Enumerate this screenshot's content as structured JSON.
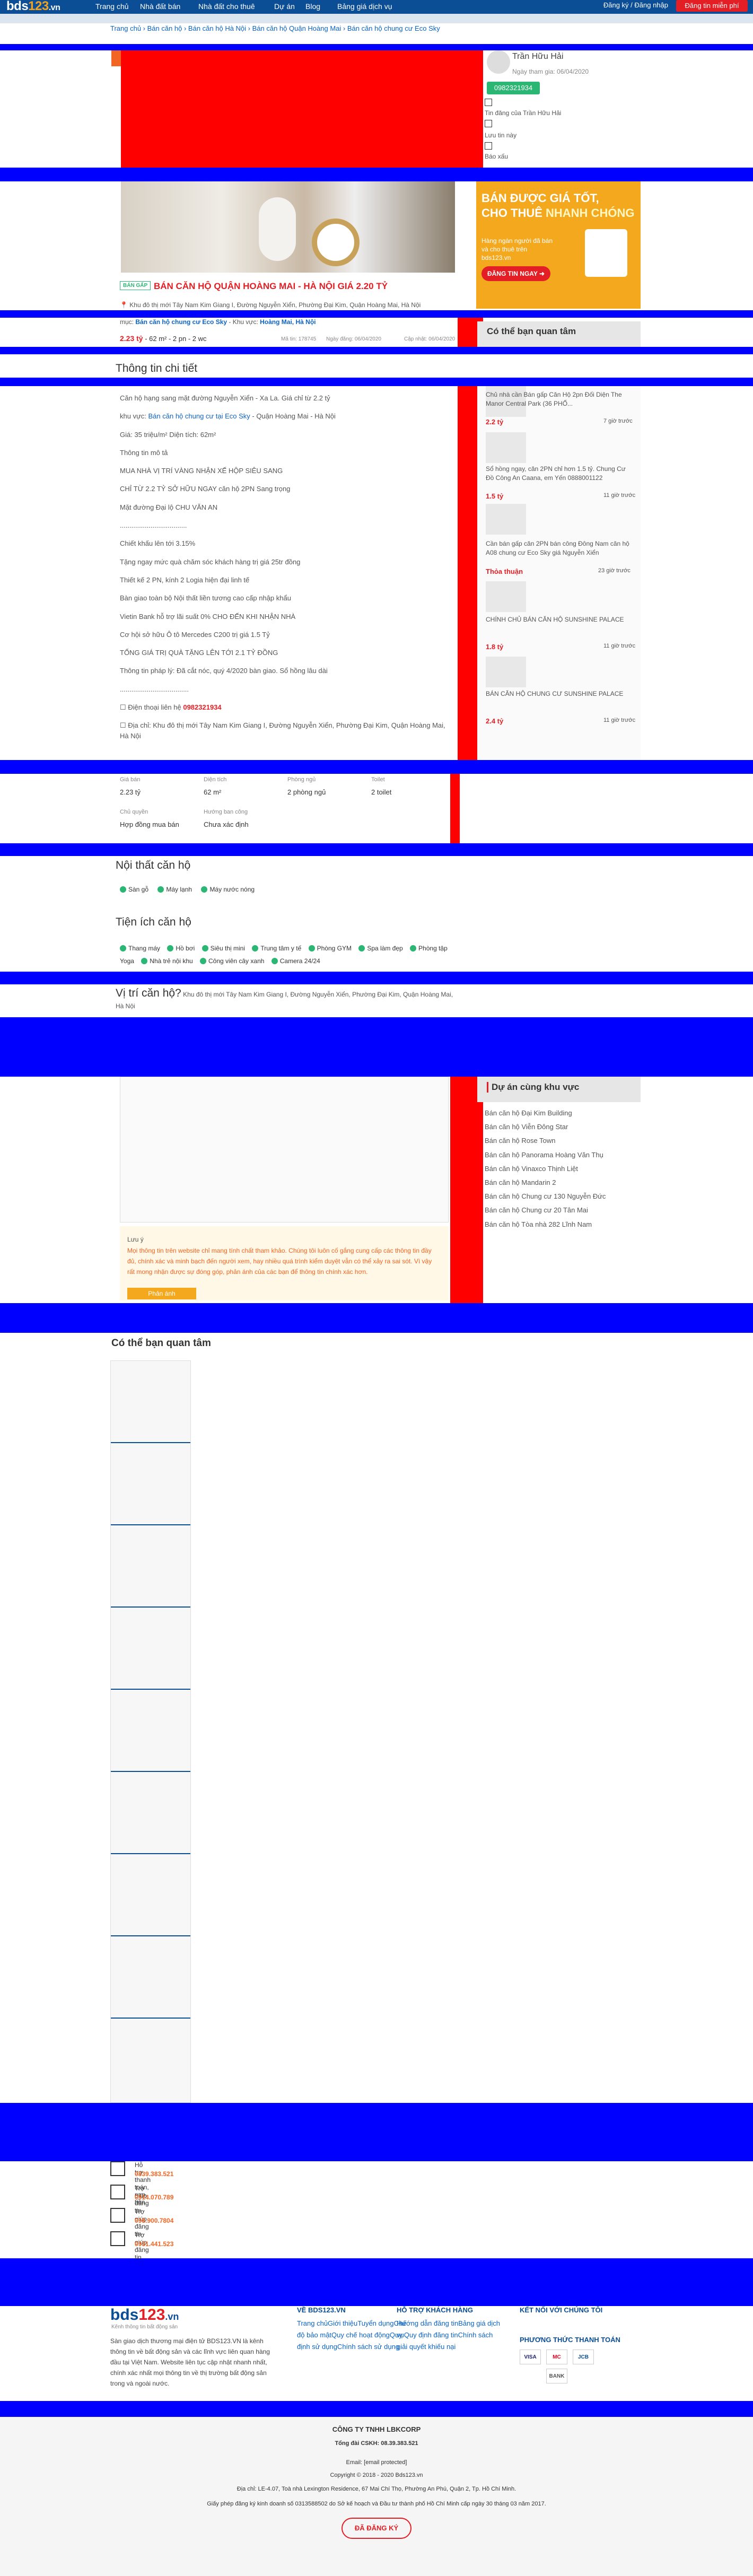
{
  "header": {
    "logo_main": "bds",
    "logo_num": "123",
    "logo_tld": ".vn",
    "nav": [
      "Trang chủ",
      "Nhà đất bán",
      "Nhà đất cho thuê",
      "Dự án",
      "Blog",
      "Bảng giá dịch vụ"
    ],
    "login": "Đăng ký / Đăng nhập",
    "post_button": "Đăng tin miễn phí"
  },
  "breadcrumb": "Trang chủ  ›  Bán căn hộ  ›  Bán căn hộ Hà Nội  ›  Bán căn hộ Quận Hoàng Mai  ›  Bán căn hộ chung cư Eco Sky",
  "seller": {
    "name": "Trần Hữu Hải",
    "joined": "Ngày tham gia: 06/04/2020",
    "phone": "0982321934",
    "more_posts": "Tin đăng của Trần Hữu Hải",
    "save": "Lưu tin này",
    "report": "Báo xấu"
  },
  "banner": {
    "line1": "BÁN ",
    "line1b": "ĐƯỢC GIÁ TỐT,",
    "line2": "CHO THUÊ ",
    "line2b": "NHANH CHÓNG",
    "text": "Hàng ngàn người đã bán và cho thuê trên bds123.vn",
    "cta": "ĐĂNG TIN NGAY ➜"
  },
  "listing": {
    "badge": "BÁN GẤP",
    "title": "BÁN CĂN HỘ QUẬN HOÀNG MAI - HÀ NỘI GIÁ 2.20 TỶ",
    "address": "Khu đô thị mới Tây Nam Kim Giang I, Đường Nguyễn Xiển, Phường Đại Kim, Quận Hoàng Mai, Hà Nội",
    "cat_label": "mục: ",
    "category": "Bán căn hộ chung cư Eco Sky",
    "area_label": " - Khu vực: ",
    "area": "Hoàng Mai, Hà Nội",
    "price": "2.23 tỷ",
    "specs": " - 62 m² - 2 pn - 2 wc",
    "code": "Mã tin: 178745",
    "posted": "Ngày đăng: 06/04/2020",
    "updated": "Cập nhật: 06/04/2020"
  },
  "detail": {
    "heading": "Thông tin chi tiết",
    "lines": [
      "Căn hộ hạng sang mặt đường Nguyễn Xiển - Xa La. Giá chỉ từ 2.2 tỷ",
      "khu vực: Bán căn hộ chung cư tại Eco Sky - Quận Hoàng Mai - Hà Nội",
      "Giá: 35 triệu/m² Diện tích: 62m²",
      "Thông tin mô tả",
      "MUA NHÀ VỊ TRÍ VÀNG NHẬN XẾ HỘP SIÊU SANG",
      "CHỈ TỪ 2.2 TỶ SỞ HỮU NGAY căn hộ 2PN Sang trọng",
      "Mặt đường Đại lộ CHU VĂN AN",
      "...................................",
      "Chiết khấu lên tới 3.15%",
      "Tặng ngay mức quà chăm sóc khách hàng trị giá 25tr đồng",
      "Thiết kế 2 PN, kính 2 Logia hiện đại linh tế",
      "Bàn giao toàn bộ Nội thất liền tương cao cấp nhập khẩu",
      "Vietin Bank hỗ trợ lãi suất 0% CHO ĐẾN KHI NHẬN NHÀ",
      "Cơ hội sở hữu Ô tô Mercedes C200 trị giá 1.5 Tỷ",
      "TỔNG GIÁ TRỊ QUÀ TẶNG LÊN TỚI 2.1 TỶ ĐỒNG",
      "Thông tin pháp lý: Đã cắt nóc, quý 4/2020 bàn giao. Sổ hồng lâu dài",
      "...................................."
    ],
    "phone_label": "☐ Điện thoại liên hệ ",
    "phone": "0982321934",
    "address_line": "☐ Địa chỉ: Khu đô thị mới Tây Nam Kim Giang I, Đường Nguyễn Xiển, Phường Đại Kim, Quận Hoàng Mai, Hà Nội"
  },
  "specs": [
    {
      "k": "Giá bán",
      "v": "2.23 tỷ"
    },
    {
      "k": "Diện tích",
      "v": "62 m²"
    },
    {
      "k": "Phòng ngủ",
      "v": "2 phòng ngủ"
    },
    {
      "k": "Toilet",
      "v": "2 toilet"
    },
    {
      "k": "Chủ quyền",
      "v": "Hợp đồng mua bán"
    },
    {
      "k": "Hướng ban công",
      "v": "Chưa xác định"
    }
  ],
  "interior": {
    "heading": "Nội thất căn hộ",
    "items": [
      "Sàn gỗ",
      "Máy lạnh",
      "Máy nước nóng"
    ]
  },
  "amenities": {
    "heading": "Tiện ích căn hộ",
    "items": [
      "Thang máy",
      "Hồ bơi",
      "Siêu thị mini",
      "Trung tâm y tế",
      "Phòng GYM",
      "Spa làm đẹp",
      "Phòng tập Yoga",
      "Nhà trẻ nội khu",
      "Công viên cây xanh",
      "Camera 24/24"
    ]
  },
  "location": {
    "heading": "Vị trí căn hộ?",
    "address": "Khu đô thị mới Tây Nam Kim Giang I, Đường Nguyễn Xiển, Phường Đại Kim, Quận Hoàng Mai, Hà Nội"
  },
  "note": {
    "title": "Lưu ý",
    "text": "Mọi thông tin trên website chỉ mang tính chất tham khảo. Chúng tôi luôn cố gắng cung cấp các thông tin đầy đủ, chính xác và minh bạch đến người xem, hay nhiều quá trình kiểm duyệt vẫn có thể xảy ra sai sót. Vì vậy rất mong nhận được sự đóng góp, phản ánh của các bạn để thông tin chính xác hơn.",
    "button": "Phản ánh"
  },
  "side_related": {
    "heading": "Có thể bạn quan tâm",
    "items": [
      {
        "title": "Chủ nhà cần Bán gấp Căn Hộ 2pn Đối Diện The Manor Central Park (36 PHỐ...",
        "price": "2.2 tỷ",
        "time": "7 giờ trước"
      },
      {
        "title": "Sổ hồng ngay, căn 2PN chỉ hơn 1.5 tỷ. Chung Cư Đồ Công An Caana, em Yến 0888001122",
        "price": "1.5 tỷ",
        "time": "11 giờ trước"
      },
      {
        "title": "Cần bán gấp căn 2PN bán công Đông Nam căn hộ A08 chung cư Eco Sky giá Nguyễn Xiển",
        "price": "Thỏa thuận",
        "time": "23 giờ trước"
      },
      {
        "title": "CHÍNH CHỦ BÁN CĂN HỘ SUNSHINE PALACE",
        "price": "1.8 tỷ",
        "time": "11 giờ trước"
      },
      {
        "title": "BÁN CĂN HỘ CHUNG CƯ SUNSHINE PALACE",
        "price": "2.4 tỷ",
        "time": "11 giờ trước"
      }
    ]
  },
  "projects": {
    "heading": "Dự án cùng khu vực",
    "items": [
      "Bán căn hộ Đại Kim Building",
      "Bán căn hộ Viễn Đông Star",
      "Bán căn hộ Rose Town",
      "Bán căn hộ Panorama Hoàng Văn Thụ",
      "Bán căn hộ Vinaxco Thịnh Liệt",
      "Bán căn hộ Mandarin 2",
      "Bán căn hộ Chung cư 130 Nguyễn Đức",
      "Bán căn hộ Chung cư 20 Tân Mai",
      "Bán căn hộ Tòa nhà 282 Lĩnh Nam"
    ]
  },
  "bottom_related": {
    "heading": "Có thể bạn quan tâm"
  },
  "support": [
    {
      "label": "Hỗ trợ thanh toán, nạp tiền",
      "phone": "0839.383.521"
    },
    {
      "label": "Trợ giúp đăng tin",
      "phone": "0914.070.789"
    },
    {
      "label": "Trợ giúp đăng tin",
      "phone": "098.900.7804"
    },
    {
      "label": "Trợ giúp đăng tin",
      "phone": "0931.441.523"
    }
  ],
  "footer": {
    "logo_main": "bds",
    "logo_num": "123",
    "logo_tld": ".vn",
    "slogan": "Kênh thông tin bất động sản",
    "about": "Sàn giao dịch thương mại điện tử BDS123.VN là kênh thông tin về bất động sản và các lĩnh vực liên quan hàng đầu tại Việt Nam. Website liên tục cập nhật nhanh nhất, chính xác nhất mọi thông tin về thị trường bất động sản trong và ngoài nước.",
    "col1_title": "VỀ BDS123.VN",
    "col1": "Trang chủGiới thiệuTuyển dụngChế độ bảo mậtQuy chế hoạt độngQuy định sử dụngChính sách sử dụng",
    "col2_title": "HỖ TRỢ KHÁCH HÀNG",
    "col2": "Hướng dẫn đăng tinBảng giá dịch vụQuy định đăng tinChính sách giải quyết khiếu nại",
    "col3_title": "KẾT NỐI VỚI CHÚNG TÔI",
    "pay_title": "PHƯƠNG THỨC THANH TOÁN",
    "pay": [
      "VISA",
      "MC",
      "JCB",
      "BANK"
    ],
    "company": "CÔNG TY TNHH LBKCORP",
    "hotline": "Tổng đài CSKH: 08.39.383.521",
    "email": "Email: [email protected]",
    "copyright": "Copyright © 2018 - 2020 Bds123.vn",
    "address": "Địa chỉ: LE-4.07, Toà nhà Lexington Residence, 67 Mai Chí Thọ, Phường An Phú, Quận 2, Tp. Hồ Chí Minh.",
    "license": "Giấy phép đăng ký kinh doanh số 0313588502 do Sở kế hoạch và Đầu tư thành phố Hồ Chí Minh cấp ngày 30 tháng 03 năm 2017.",
    "cert": "ĐÃ ĐĂNG KÝ"
  }
}
